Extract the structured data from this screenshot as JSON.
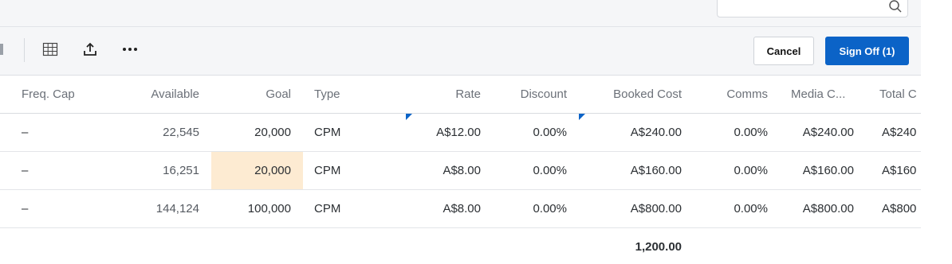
{
  "columns": [
    {
      "key": "freq_cap",
      "label": "Freq. Cap"
    },
    {
      "key": "available",
      "label": "Available"
    },
    {
      "key": "goal",
      "label": "Goal"
    },
    {
      "key": "type",
      "label": "Type"
    },
    {
      "key": "rate",
      "label": "Rate"
    },
    {
      "key": "discount",
      "label": "Discount"
    },
    {
      "key": "booked_cost",
      "label": "Booked Cost"
    },
    {
      "key": "comms",
      "label": "Comms"
    },
    {
      "key": "media_cost",
      "label": "Media C..."
    },
    {
      "key": "total_cost",
      "label": "Total C"
    }
  ],
  "rows": [
    {
      "freq_cap": "–",
      "available": "22,545",
      "goal": "20,000",
      "type": "CPM",
      "rate": "A$12.00",
      "discount": "0.00%",
      "booked_cost": "A$240.00",
      "comms": "0.00%",
      "media_cost": "A$240.00",
      "total_cost": "A$240"
    },
    {
      "freq_cap": "–",
      "available": "16,251",
      "goal": "20,000",
      "type": "CPM",
      "rate": "A$8.00",
      "discount": "0.00%",
      "booked_cost": "A$160.00",
      "comms": "0.00%",
      "media_cost": "A$160.00",
      "total_cost": "A$160"
    },
    {
      "freq_cap": "–",
      "available": "144,124",
      "goal": "100,000",
      "type": "CPM",
      "rate": "A$8.00",
      "discount": "0.00%",
      "booked_cost": "A$800.00",
      "comms": "0.00%",
      "media_cost": "A$800.00",
      "total_cost": "A$800"
    }
  ],
  "totals": {
    "booked_cost": "1,200.00"
  },
  "toolbar": {
    "grid_icon": "grid-icon",
    "export_icon": "upload-icon",
    "more_icon": "more-horizontal-icon",
    "cancel_label": "Cancel",
    "signoff_label": "Sign Off (1)"
  },
  "search": {
    "icon": "search-icon",
    "placeholder": ""
  },
  "colors": {
    "primary": "#0b63c7",
    "highlight": "#fdebd2",
    "flag": "#0b63c7"
  }
}
